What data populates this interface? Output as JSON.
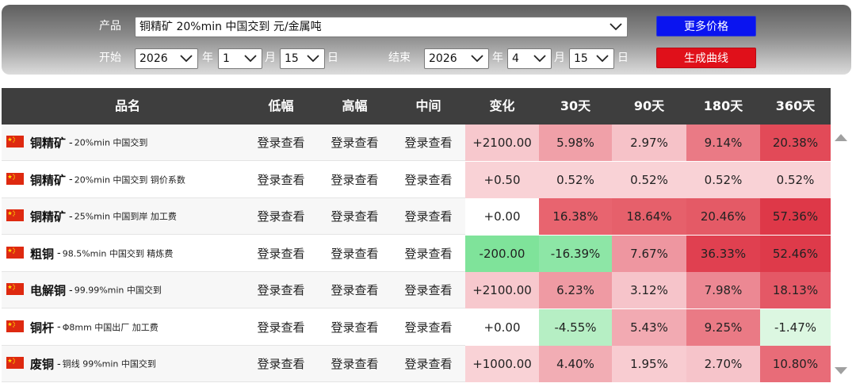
{
  "controls": {
    "product_label": "产品",
    "product_value": "铜精矿 20%min 中国交到 元/金属吨",
    "start_label": "开始",
    "end_label": "结束",
    "start_year": "2026",
    "start_month": "1",
    "start_day": "15",
    "end_year": "2026",
    "end_month": "4",
    "end_day": "15",
    "year_unit": "年",
    "month_unit": "月",
    "day_unit": "日",
    "more_prices_button": "更多价格",
    "generate_chart_button": "生成曲线"
  },
  "table": {
    "headers": [
      "品名",
      "低幅",
      "高幅",
      "中间",
      "变化",
      "30天",
      "90天",
      "180天",
      "360天"
    ],
    "login_text": "登录查看",
    "rows": [
      {
        "name": "铜精矿",
        "desc": "20%min 中国交到",
        "change": "+2100.00",
        "d30": "5.98%",
        "d90": "2.97%",
        "d180": "9.14%",
        "d360": "20.38%",
        "colors": {
          "change": "#f7c8cd",
          "d30": "#f0a0a8",
          "d90": "#f6c2c8",
          "d180": "#ea7a85",
          "d360": "#e24a58"
        }
      },
      {
        "name": "铜精矿",
        "desc": "20%min 中国交到 铜价系数",
        "change": "+0.50",
        "d30": "0.52%",
        "d90": "0.52%",
        "d180": "0.52%",
        "d360": "0.52%",
        "colors": {
          "change": "#f9d2d6",
          "d30": "#f9d2d6",
          "d90": "#f9d2d6",
          "d180": "#f9d2d6",
          "d360": "#f9d2d6"
        }
      },
      {
        "name": "铜精矿",
        "desc": "25%min 中国到岸 加工费",
        "change": "+0.00",
        "d30": "16.38%",
        "d90": "18.64%",
        "d180": "20.46%",
        "d360": "57.36%",
        "colors": {
          "change": "#ffffff",
          "d30": "#e8646f",
          "d90": "#e6606b",
          "d180": "#e45a66",
          "d360": "#de3848"
        }
      },
      {
        "name": "粗铜",
        "desc": "98.5%min 中国交到 精炼费",
        "change": "-200.00",
        "d30": "-16.39%",
        "d90": "7.67%",
        "d180": "36.33%",
        "d360": "52.46%",
        "colors": {
          "change": "#7fe39a",
          "d30": "#8de6a6",
          "d90": "#ee96a0",
          "d180": "#e04050",
          "d360": "#de3a4a"
        }
      },
      {
        "name": "电解铜",
        "desc": "99.99%min 中国交到",
        "change": "+2100.00",
        "d30": "6.23%",
        "d90": "3.12%",
        "d180": "7.98%",
        "d360": "18.13%",
        "colors": {
          "change": "#f7c8cd",
          "d30": "#ef9aa3",
          "d90": "#f6c4ca",
          "d180": "#ec8893",
          "d360": "#e45866"
        }
      },
      {
        "name": "铜杆",
        "desc": "Φ8mm 中国出厂 加工费",
        "change": "+0.00",
        "d30": "-4.55%",
        "d90": "5.43%",
        "d180": "9.25%",
        "d360": "-1.47%",
        "colors": {
          "change": "#ffffff",
          "d30": "#b6efc4",
          "d90": "#f2aab2",
          "d180": "#ea7a85",
          "d360": "#dcf7e1"
        }
      },
      {
        "name": "废铜",
        "desc": "铜线 99%min 中国交到",
        "change": "+1000.00",
        "d30": "4.40%",
        "d90": "1.95%",
        "d180": "2.70%",
        "d360": "10.80%",
        "colors": {
          "change": "#f9d2d6",
          "d30": "#f2adb4",
          "d90": "#f8ccd1",
          "d180": "#f6c4ca",
          "d360": "#e86c78"
        }
      }
    ]
  }
}
